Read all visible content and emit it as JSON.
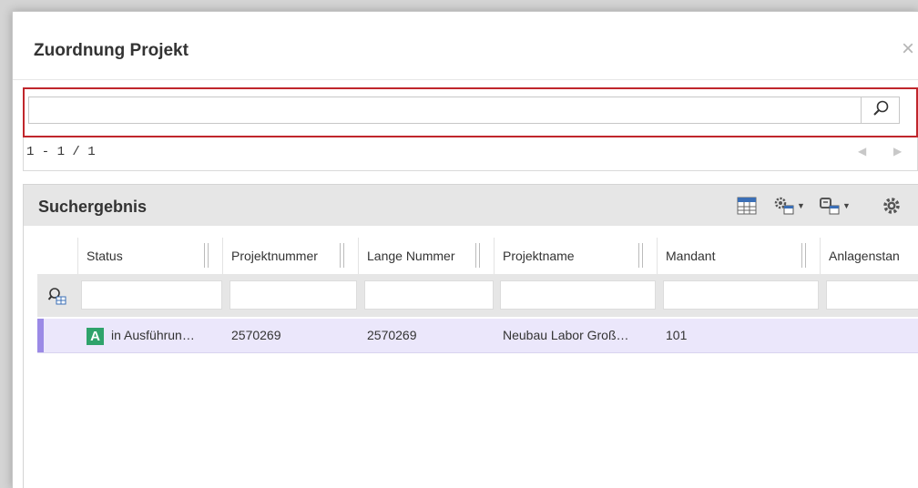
{
  "dialog": {
    "title": "Zuordnung Projekt",
    "close_glyph": "×"
  },
  "search": {
    "value": "",
    "placeholder": ""
  },
  "pager": {
    "range_text": "1 - 1 / 1",
    "prev_glyph": "◀",
    "next_glyph": "▶"
  },
  "results": {
    "title": "Suchergebnis",
    "columns": [
      "Status",
      "Projektnummer",
      "Lange Nummer",
      "Projektname",
      "Mandant",
      "Anlagenstan"
    ],
    "rows": [
      {
        "status_badge": "A",
        "status": "in Ausführun…",
        "projektnummer": "2570269",
        "lange_nummer": "2570269",
        "projektname": "Neubau Labor Groß…",
        "mandant": "101",
        "anlagenstand": ""
      }
    ]
  },
  "colors": {
    "accent_red": "#c0262c",
    "selected_row": "#ebe7fb",
    "selection_bar": "#9b8ae6",
    "badge_green": "#2fa36b",
    "icon_blue": "#3b6fb6"
  }
}
